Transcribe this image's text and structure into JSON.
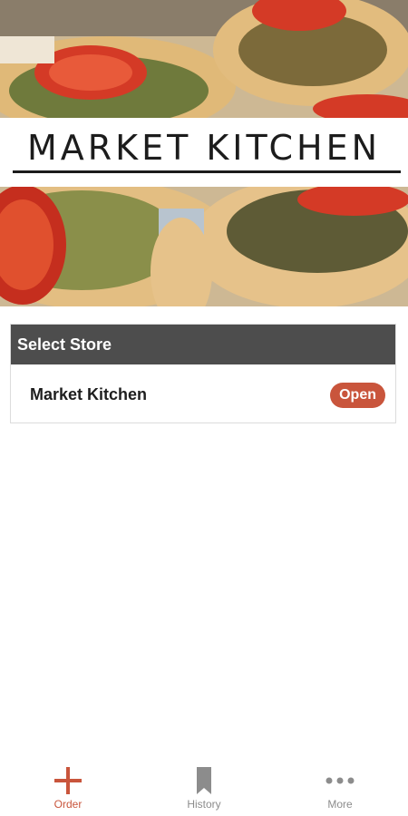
{
  "brand": {
    "title": "MARKET KITCHEN"
  },
  "store_select": {
    "header": "Select Store",
    "stores": [
      {
        "name": "Market Kitchen",
        "status": "Open"
      }
    ]
  },
  "bottom_nav": {
    "items": [
      {
        "label": "Order",
        "icon": "plus-icon",
        "active": true
      },
      {
        "label": "History",
        "icon": "bookmark-icon",
        "active": false
      },
      {
        "label": "More",
        "icon": "more-dots-icon",
        "active": false
      }
    ]
  },
  "colors": {
    "accent": "#c9553c",
    "header_bg": "#4d4d4d",
    "nav_inactive": "#8c8c8c"
  }
}
